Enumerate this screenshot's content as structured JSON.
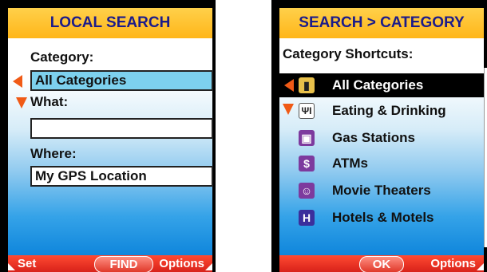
{
  "left": {
    "header": "LOCAL SEARCH",
    "category_label": "Category:",
    "category_value": "All Categories",
    "what_label": "What:",
    "what_value": "",
    "where_label": "Where:",
    "where_value": "My GPS Location",
    "soft_left": "Set",
    "soft_center": "FIND",
    "soft_right": "Options"
  },
  "right": {
    "header": "SEARCH > CATEGORY",
    "shortcuts_label": "Category Shortcuts:",
    "items": [
      {
        "label": "All Categories",
        "icon": "folder-icon"
      },
      {
        "label": "Eating & Drinking",
        "icon": "fork-knife-icon"
      },
      {
        "label": "Gas Stations",
        "icon": "gas-pump-icon"
      },
      {
        "label": "ATMs",
        "icon": "dollar-icon"
      },
      {
        "label": "Movie Theaters",
        "icon": "theater-masks-icon"
      },
      {
        "label": "Hotels & Motels",
        "icon": "hotel-icon"
      }
    ],
    "soft_center": "OK",
    "soft_right": "Options"
  },
  "colors": {
    "header_bg": "#ffc22e",
    "header_text": "#1c1c8a",
    "softbar_bg": "#e02a1c",
    "selection_bg": "#7dd1ee",
    "arrow": "#f05a16",
    "icon_purple": "#7d3a9e"
  }
}
